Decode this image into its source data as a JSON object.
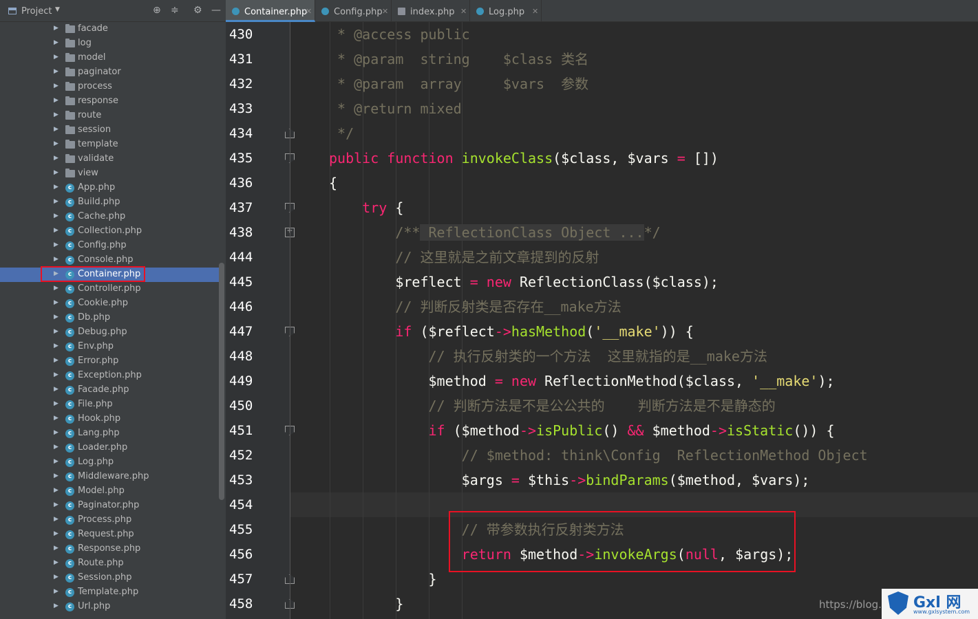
{
  "project_panel": {
    "title": "Project",
    "tree": [
      {
        "label": "facade",
        "kind": "folder"
      },
      {
        "label": "log",
        "kind": "folder"
      },
      {
        "label": "model",
        "kind": "folder"
      },
      {
        "label": "paginator",
        "kind": "folder"
      },
      {
        "label": "process",
        "kind": "folder"
      },
      {
        "label": "response",
        "kind": "folder"
      },
      {
        "label": "route",
        "kind": "folder"
      },
      {
        "label": "session",
        "kind": "folder"
      },
      {
        "label": "template",
        "kind": "folder"
      },
      {
        "label": "validate",
        "kind": "folder"
      },
      {
        "label": "view",
        "kind": "folder"
      },
      {
        "label": "App.php",
        "kind": "class"
      },
      {
        "label": "Build.php",
        "kind": "class"
      },
      {
        "label": "Cache.php",
        "kind": "class"
      },
      {
        "label": "Collection.php",
        "kind": "class"
      },
      {
        "label": "Config.php",
        "kind": "class"
      },
      {
        "label": "Console.php",
        "kind": "class"
      },
      {
        "label": "Container.php",
        "kind": "class",
        "selected": true
      },
      {
        "label": "Controller.php",
        "kind": "class"
      },
      {
        "label": "Cookie.php",
        "kind": "class"
      },
      {
        "label": "Db.php",
        "kind": "class"
      },
      {
        "label": "Debug.php",
        "kind": "class"
      },
      {
        "label": "Env.php",
        "kind": "class"
      },
      {
        "label": "Error.php",
        "kind": "class"
      },
      {
        "label": "Exception.php",
        "kind": "class"
      },
      {
        "label": "Facade.php",
        "kind": "class"
      },
      {
        "label": "File.php",
        "kind": "class"
      },
      {
        "label": "Hook.php",
        "kind": "class"
      },
      {
        "label": "Lang.php",
        "kind": "class"
      },
      {
        "label": "Loader.php",
        "kind": "class"
      },
      {
        "label": "Log.php",
        "kind": "class"
      },
      {
        "label": "Middleware.php",
        "kind": "class"
      },
      {
        "label": "Model.php",
        "kind": "class"
      },
      {
        "label": "Paginator.php",
        "kind": "class"
      },
      {
        "label": "Process.php",
        "kind": "class"
      },
      {
        "label": "Request.php",
        "kind": "class"
      },
      {
        "label": "Response.php",
        "kind": "class"
      },
      {
        "label": "Route.php",
        "kind": "class"
      },
      {
        "label": "Session.php",
        "kind": "class"
      },
      {
        "label": "Template.php",
        "kind": "class"
      },
      {
        "label": "Url.php",
        "kind": "class"
      }
    ]
  },
  "tabs": [
    {
      "label": "Container.php",
      "icon": "class-icon",
      "active": true
    },
    {
      "label": "Config.php",
      "icon": "class-icon",
      "active": false
    },
    {
      "label": "index.php",
      "icon": "php-file-icon",
      "active": false
    },
    {
      "label": "Log.php",
      "icon": "class-icon",
      "active": false
    }
  ],
  "editor": {
    "current_line": "454",
    "lines": [
      {
        "n": "430",
        "fold": "",
        "tokens": [
          {
            "c": "cmt",
            "t": " * @access public"
          }
        ]
      },
      {
        "n": "431",
        "fold": "",
        "tokens": [
          {
            "c": "cmt",
            "t": " * @param  string    $class 类名"
          }
        ]
      },
      {
        "n": "432",
        "fold": "",
        "tokens": [
          {
            "c": "cmt",
            "t": " * @param  array     $vars  参数"
          }
        ]
      },
      {
        "n": "433",
        "fold": "",
        "tokens": [
          {
            "c": "cmt",
            "t": " * @return mixed"
          }
        ]
      },
      {
        "n": "434",
        "fold": "up",
        "tokens": [
          {
            "c": "cmt",
            "t": " */"
          }
        ]
      },
      {
        "n": "435",
        "fold": "down",
        "tokens": [
          {
            "c": "kw",
            "t": "public "
          },
          {
            "c": "kw",
            "t": "function "
          },
          {
            "c": "fn",
            "t": "invokeClass"
          },
          {
            "c": "var",
            "t": "($class, $vars "
          },
          {
            "c": "op",
            "t": "="
          },
          {
            "c": "var",
            "t": " [])"
          }
        ]
      },
      {
        "n": "436",
        "fold": "",
        "tokens": [
          {
            "c": "var",
            "t": "{"
          }
        ]
      },
      {
        "n": "437",
        "fold": "down",
        "tokens": [
          {
            "c": "kw",
            "t": "    try "
          },
          {
            "c": "var",
            "t": "{"
          }
        ]
      },
      {
        "n": "438",
        "fold": "plus",
        "tokens": [
          {
            "c": "cmt",
            "t": "        /**"
          },
          {
            "c": "fold-text",
            "t": " ReflectionClass Object ..."
          },
          {
            "c": "cmt",
            "t": "*/"
          }
        ]
      },
      {
        "n": "444",
        "fold": "",
        "tokens": [
          {
            "c": "cmt",
            "t": "        // 这里就是之前文章提到的反射"
          }
        ]
      },
      {
        "n": "445",
        "fold": "",
        "tokens": [
          {
            "c": "var",
            "t": "        $reflect "
          },
          {
            "c": "op",
            "t": "="
          },
          {
            "c": "kw",
            "t": " new "
          },
          {
            "c": "var",
            "t": "ReflectionClass($class);"
          }
        ]
      },
      {
        "n": "446",
        "fold": "",
        "tokens": [
          {
            "c": "cmt",
            "t": "        // 判断反射类是否存在__make方法"
          }
        ]
      },
      {
        "n": "447",
        "fold": "down",
        "tokens": [
          {
            "c": "kw",
            "t": "        if "
          },
          {
            "c": "var",
            "t": "($reflect"
          },
          {
            "c": "op",
            "t": "->"
          },
          {
            "c": "fn",
            "t": "hasMethod"
          },
          {
            "c": "var",
            "t": "("
          },
          {
            "c": "str",
            "t": "'__make'"
          },
          {
            "c": "var",
            "t": ")) {"
          }
        ]
      },
      {
        "n": "448",
        "fold": "",
        "tokens": [
          {
            "c": "cmt",
            "t": "            // 执行反射类的一个方法  这里就指的是__make方法"
          }
        ]
      },
      {
        "n": "449",
        "fold": "",
        "tokens": [
          {
            "c": "var",
            "t": "            $method "
          },
          {
            "c": "op",
            "t": "="
          },
          {
            "c": "kw",
            "t": " new "
          },
          {
            "c": "var",
            "t": "ReflectionMethod($class, "
          },
          {
            "c": "str",
            "t": "'__make'"
          },
          {
            "c": "var",
            "t": ");"
          }
        ]
      },
      {
        "n": "450",
        "fold": "",
        "tokens": [
          {
            "c": "cmt",
            "t": "            // 判断方法是不是公公共的    判断方法是不是静态的"
          }
        ]
      },
      {
        "n": "451",
        "fold": "down",
        "tokens": [
          {
            "c": "kw",
            "t": "            if "
          },
          {
            "c": "var",
            "t": "($method"
          },
          {
            "c": "op",
            "t": "->"
          },
          {
            "c": "fn",
            "t": "isPublic"
          },
          {
            "c": "var",
            "t": "() "
          },
          {
            "c": "op",
            "t": "&&"
          },
          {
            "c": "var",
            "t": " $method"
          },
          {
            "c": "op",
            "t": "->"
          },
          {
            "c": "fn",
            "t": "isStatic"
          },
          {
            "c": "var",
            "t": "()) {"
          }
        ]
      },
      {
        "n": "452",
        "fold": "",
        "tokens": [
          {
            "c": "cmt",
            "t": "                // $method: think\\Config  ReflectionMethod Object"
          }
        ]
      },
      {
        "n": "453",
        "fold": "",
        "tokens": [
          {
            "c": "var",
            "t": "                $args "
          },
          {
            "c": "op",
            "t": "="
          },
          {
            "c": "var",
            "t": " $this"
          },
          {
            "c": "op",
            "t": "->"
          },
          {
            "c": "fn",
            "t": "bindParams"
          },
          {
            "c": "var",
            "t": "($method, $vars);"
          }
        ]
      },
      {
        "n": "454",
        "fold": "",
        "tokens": [
          {
            "c": "var",
            "t": ""
          }
        ]
      },
      {
        "n": "455",
        "fold": "",
        "tokens": [
          {
            "c": "cmt",
            "t": "                // 带参数执行反射类方法"
          }
        ]
      },
      {
        "n": "456",
        "fold": "",
        "tokens": [
          {
            "c": "kw",
            "t": "                return "
          },
          {
            "c": "var",
            "t": "$method"
          },
          {
            "c": "op",
            "t": "->"
          },
          {
            "c": "fn",
            "t": "invokeArgs"
          },
          {
            "c": "var",
            "t": "("
          },
          {
            "c": "kw",
            "t": "null"
          },
          {
            "c": "var",
            "t": ", $args);"
          }
        ]
      },
      {
        "n": "457",
        "fold": "up",
        "tokens": [
          {
            "c": "var",
            "t": "            }"
          }
        ]
      },
      {
        "n": "458",
        "fold": "up",
        "tokens": [
          {
            "c": "var",
            "t": "        }"
          }
        ]
      }
    ]
  },
  "watermark": {
    "url_text": "https://blog.c",
    "brand": "Gxl 网",
    "site": "www.gxlsystem.com"
  },
  "colors": {
    "keyword": "#f92672",
    "function": "#a6e22e",
    "string": "#e6db74",
    "comment": "#75715e",
    "selection": "#4b6eaf",
    "highlight_box": "#e81123"
  }
}
